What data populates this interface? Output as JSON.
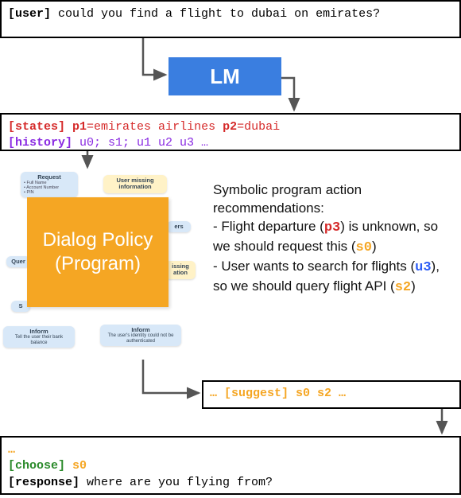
{
  "user": {
    "tag": "[user]",
    "text": " could you find a flight to dubai on emirates?"
  },
  "lm": {
    "label": "LM"
  },
  "states": {
    "tag": "[states]",
    "p1k": "p1",
    "p1v": "=emirates airlines ",
    "p2k": "p2",
    "p2v": "=dubai"
  },
  "history": {
    "tag": "[history]",
    "text": " u0; s1; u1 u2 u3 …"
  },
  "dialog_policy": {
    "label": "Dialog Policy (Program)"
  },
  "flowchart": {
    "request": {
      "title": "Request",
      "bullets": "• Full Name\n• Account Number\n• PIN"
    },
    "user_missing": {
      "title": "User missing information"
    },
    "ers": {
      "title": "ers"
    },
    "missing": {
      "title": "issing ation"
    },
    "query": {
      "title": "Quer"
    },
    "s": {
      "title": "S"
    },
    "inform_left": {
      "title": "Inform",
      "body": "Tell the user their bank balance"
    },
    "inform_right": {
      "title": "Inform",
      "body": "The user's identity could not be authenticated"
    }
  },
  "recs": {
    "heading": "Symbolic program action recommendations:",
    "item1_a": " - Flight departure (",
    "item1_sym": "p3",
    "item1_b": ") is unknown, so we should request this (",
    "item1_sym2": "s0",
    "item1_c": ")",
    "item2_a": " - User wants to search for flights (",
    "item2_sym": "u3",
    "item2_b": "), so we should query flight API (",
    "item2_sym2": "s2",
    "item2_c": ")"
  },
  "suggest": {
    "text": "… [suggest] s0 s2 …"
  },
  "bottom": {
    "dots": "…",
    "choose_tag": "[choose]",
    "choose_val": " s0",
    "response_tag": "[response]",
    "response_text": " where are you flying from?"
  }
}
